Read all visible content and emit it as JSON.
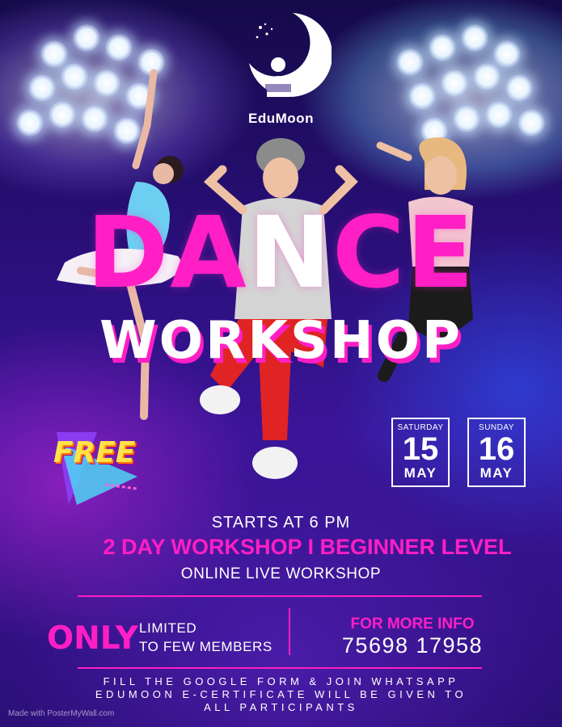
{
  "brand": {
    "name": "EduMoon"
  },
  "title": {
    "dance_pink_1": "DA",
    "dance_white": "N",
    "dance_pink_2": "CE",
    "workshop": "WORKSHOP"
  },
  "badge": {
    "free": "FREE"
  },
  "dates": [
    {
      "day": "SATURDAY",
      "num": "15",
      "month": "MAY"
    },
    {
      "day": "SUNDAY",
      "num": "16",
      "month": "MAY"
    }
  ],
  "details": {
    "starts": "STARTS AT 6 PM",
    "two_day": "2 DAY WORKSHOP I  BEGINNER LEVEL",
    "online": "ONLINE LIVE WORKSHOP"
  },
  "limited": {
    "only": "ONLY",
    "line1": "LIMITED",
    "line2": "TO FEW MEMBERS"
  },
  "contact": {
    "more_info": "FOR MORE INFO",
    "phone": "75698 17958"
  },
  "footer": {
    "line1": "FILL THE GOOGLE FORM & JOIN WHATSAPP",
    "line2": "EDUMOON E-CERTIFICATE WILL BE GIVEN TO",
    "line3": "ALL PARTICIPANTS"
  },
  "watermark": "Made with PosterMyWall.com",
  "colors": {
    "accent_pink": "#ff1fc4",
    "background": "#2a0f7a",
    "text": "#ffffff"
  }
}
